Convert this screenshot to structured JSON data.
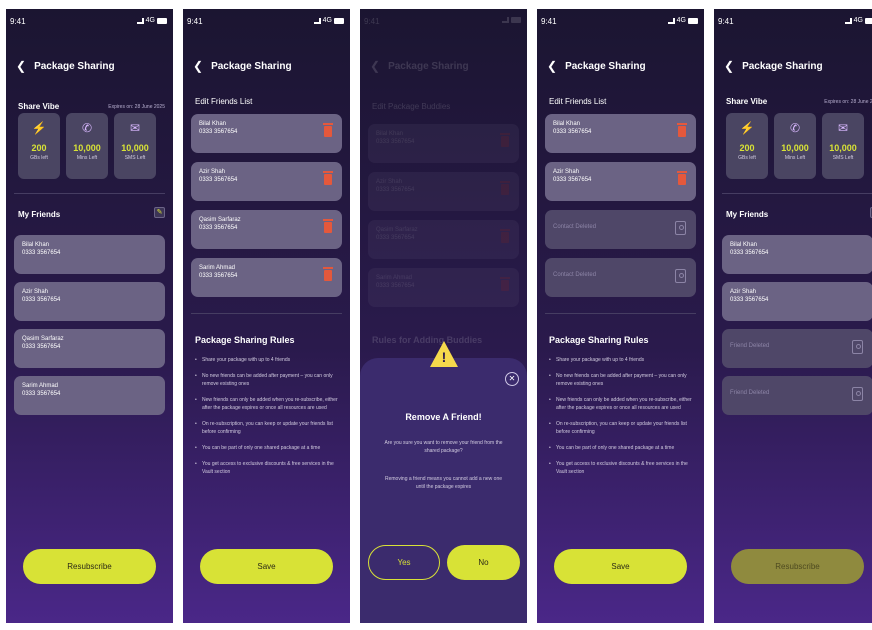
{
  "status": {
    "time": "9:41",
    "network": "4G"
  },
  "header": {
    "title": "Package Sharing",
    "title_faded": "Package Sharing"
  },
  "share": {
    "title": "Share Vibe",
    "expires": "Expires on: 28 June 2025"
  },
  "tiles": [
    {
      "icon": "data-icon",
      "value": "200",
      "label": "GBs left"
    },
    {
      "icon": "phone-icon",
      "value": "10,000",
      "label": "Mins Left"
    },
    {
      "icon": "sms-icon",
      "value": "10,000",
      "label": "SMS Left"
    }
  ],
  "friends_title": "My Friends",
  "edit_title": "Edit Friends List",
  "edit_title_faded": "Edit Package Buddies",
  "friends": [
    {
      "name": "Bilal Khan",
      "number": "0333 3567654"
    },
    {
      "name": "Azir Shah",
      "number": "0333 3567654"
    },
    {
      "name": "Qasim Sarfaraz",
      "number": "0333 3567654"
    },
    {
      "name": "Sarim Ahmad",
      "number": "0333 3567654"
    }
  ],
  "contact_deleted": "Contact Deleted",
  "friend_deleted": "Friend Deleted",
  "rules_title": "Package Sharing Rules",
  "rules_title_faded": "Rules for Adding Buddies",
  "rules": [
    "Share your package with up to 4 friends",
    "No new friends can be added after payment – you can only remove existing ones",
    "New friends can only be added when you re-subscribe, either after the package expires or once all resources are used",
    "On re-subscription, you can keep or update your friends list before confirming",
    "You can be part of only one shared package at a time",
    "You get access to exclusive discounts & free services in the Vault section"
  ],
  "buttons": {
    "resubscribe": "Resubscribe",
    "save": "Save"
  },
  "dialog": {
    "title": "Remove A Friend!",
    "text1": "Are you sure you want to remove your friend from the shared package?",
    "text2": "Removing a friend means you cannot add a new one until the package expires",
    "yes": "Yes",
    "no": "No",
    "close": "✕"
  },
  "colors": {
    "accent": "#d8e236",
    "danger": "#e4583c",
    "card": "#6b6384"
  }
}
